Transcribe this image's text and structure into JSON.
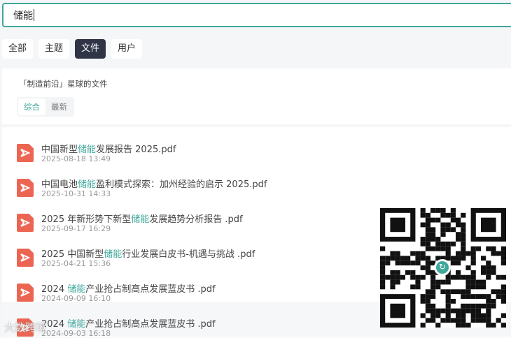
{
  "search": {
    "value": "储能"
  },
  "tabs": [
    {
      "label": "全部"
    },
    {
      "label": "主题"
    },
    {
      "label": "文件",
      "active": true
    },
    {
      "label": "用户"
    }
  ],
  "panel": {
    "title": "「制造前沿」星球的文件",
    "sort": [
      {
        "label": "综合",
        "active": true
      },
      {
        "label": "最新"
      }
    ]
  },
  "files": [
    {
      "pre": "中国新型",
      "hl": "储能",
      "post": "发展报告 2025.pdf",
      "time": "2025-08-18 13:49"
    },
    {
      "pre": "中国电池",
      "hl": "储能",
      "post": "盈利模式探索：加州经验的启示 2025.pdf",
      "time": "2025-10-31 14:33"
    },
    {
      "pre": "2025 年新形势下新型",
      "hl": "储能",
      "post": "发展趋势分析报告 .pdf",
      "time": "2025-09-17 16:29"
    },
    {
      "pre": "2025 中国新型",
      "hl": "储能",
      "post": "行业发展白皮书-机遇与挑战 .pdf",
      "time": "2025-04-21 15:36"
    },
    {
      "pre": "2024 ",
      "hl": "储能",
      "post": "产业抢占制高点发展蓝皮书 .pdf",
      "time": "2024-09-09 16:10"
    },
    {
      "pre": "2024 ",
      "hl": "储能",
      "post": "产业抢占制高点发展蓝皮书 .pdf",
      "time": "2024-09-03 16:18"
    }
  ],
  "watermark": "大数跨境",
  "colors": {
    "accent": "#3ea89b",
    "pdf": "#ec6553",
    "activeTab": "#2f3447"
  }
}
